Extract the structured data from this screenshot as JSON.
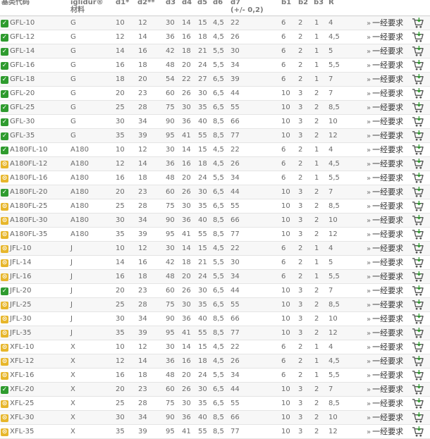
{
  "header": {
    "code": "基类代码",
    "material_line1": "iglidur®",
    "material_line2": "材料",
    "d1": "d1*",
    "d2": "d2**",
    "d3": "d3",
    "d4": "d4",
    "d5": "d5",
    "d6": "d6",
    "d7_line1": "d7",
    "d7_line2": "(+/- 0,2)",
    "b1": "b1",
    "b2": "b2",
    "b3": "b3",
    "r": "R"
  },
  "link": {
    "arrow": "»",
    "label": "一经要求"
  },
  "colors": {
    "green": "#2e9b2e",
    "yellow": "#e7b62b"
  },
  "rows": [
    {
      "status": "green",
      "status_icon": "check-icon",
      "code": "GFL-10",
      "material": "G",
      "d1": "10",
      "d2": "12",
      "d3": "30",
      "d4": "14",
      "d5": "15",
      "d6": "4,5",
      "d7": "22",
      "b1": "6",
      "b2": "2",
      "b3": "1",
      "r": "4"
    },
    {
      "status": "green",
      "status_icon": "check-icon",
      "code": "GFL-12",
      "material": "G",
      "d1": "12",
      "d2": "14",
      "d3": "36",
      "d4": "16",
      "d5": "18",
      "d6": "4,5",
      "d7": "26",
      "b1": "6",
      "b2": "2",
      "b3": "1",
      "r": "4,5"
    },
    {
      "status": "green",
      "status_icon": "check-icon",
      "code": "GFL-14",
      "material": "G",
      "d1": "14",
      "d2": "16",
      "d3": "42",
      "d4": "18",
      "d5": "21",
      "d6": "5,5",
      "d7": "30",
      "b1": "6",
      "b2": "2",
      "b3": "1",
      "r": "5"
    },
    {
      "status": "green",
      "status_icon": "check-icon",
      "code": "GFL-16",
      "material": "G",
      "d1": "16",
      "d2": "18",
      "d3": "48",
      "d4": "20",
      "d5": "24",
      "d6": "5,5",
      "d7": "34",
      "b1": "6",
      "b2": "2",
      "b3": "1",
      "r": "5,5"
    },
    {
      "status": "green",
      "status_icon": "check-icon",
      "code": "GFL-18",
      "material": "G",
      "d1": "18",
      "d2": "20",
      "d3": "54",
      "d4": "22",
      "d5": "27",
      "d6": "6,5",
      "d7": "39",
      "b1": "6",
      "b2": "2",
      "b3": "1",
      "r": "7"
    },
    {
      "status": "green",
      "status_icon": "check-icon",
      "code": "GFL-20",
      "material": "G",
      "d1": "20",
      "d2": "23",
      "d3": "60",
      "d4": "26",
      "d5": "30",
      "d6": "6,5",
      "d7": "44",
      "b1": "10",
      "b2": "3",
      "b3": "2",
      "r": "7"
    },
    {
      "status": "green",
      "status_icon": "check-icon",
      "code": "GFL-25",
      "material": "G",
      "d1": "25",
      "d2": "28",
      "d3": "75",
      "d4": "30",
      "d5": "35",
      "d6": "6,5",
      "d7": "55",
      "b1": "10",
      "b2": "3",
      "b3": "2",
      "r": "8,5"
    },
    {
      "status": "green",
      "status_icon": "check-icon",
      "code": "GFL-30",
      "material": "G",
      "d1": "30",
      "d2": "34",
      "d3": "90",
      "d4": "36",
      "d5": "40",
      "d6": "8,5",
      "d7": "66",
      "b1": "10",
      "b2": "3",
      "b3": "2",
      "r": "10"
    },
    {
      "status": "green",
      "status_icon": "check-icon",
      "code": "GFL-35",
      "material": "G",
      "d1": "35",
      "d2": "39",
      "d3": "95",
      "d4": "41",
      "d5": "55",
      "d6": "8,5",
      "d7": "77",
      "b1": "10",
      "b2": "3",
      "b3": "2",
      "r": "12"
    },
    {
      "status": "green",
      "status_icon": "check-icon",
      "code": "A180FL-10",
      "material": "A180",
      "d1": "10",
      "d2": "12",
      "d3": "30",
      "d4": "14",
      "d5": "15",
      "d6": "4,5",
      "d7": "22",
      "b1": "6",
      "b2": "2",
      "b3": "1",
      "r": "4"
    },
    {
      "status": "yellow",
      "status_icon": "clock-icon",
      "code": "A180FL-12",
      "material": "A180",
      "d1": "12",
      "d2": "14",
      "d3": "36",
      "d4": "16",
      "d5": "18",
      "d6": "4,5",
      "d7": "26",
      "b1": "6",
      "b2": "2",
      "b3": "1",
      "r": "4,5"
    },
    {
      "status": "yellow",
      "status_icon": "clock-icon",
      "code": "A180FL-16",
      "material": "A180",
      "d1": "16",
      "d2": "18",
      "d3": "48",
      "d4": "20",
      "d5": "24",
      "d6": "5,5",
      "d7": "34",
      "b1": "6",
      "b2": "2",
      "b3": "1",
      "r": "5,5"
    },
    {
      "status": "green",
      "status_icon": "check-icon",
      "code": "A180FL-20",
      "material": "A180",
      "d1": "20",
      "d2": "23",
      "d3": "60",
      "d4": "26",
      "d5": "30",
      "d6": "6,5",
      "d7": "44",
      "b1": "10",
      "b2": "3",
      "b3": "2",
      "r": "7"
    },
    {
      "status": "yellow",
      "status_icon": "clock-icon",
      "code": "A180FL-25",
      "material": "A180",
      "d1": "25",
      "d2": "28",
      "d3": "75",
      "d4": "30",
      "d5": "35",
      "d6": "6,5",
      "d7": "55",
      "b1": "10",
      "b2": "3",
      "b3": "2",
      "r": "8,5"
    },
    {
      "status": "yellow",
      "status_icon": "clock-icon",
      "code": "A180FL-30",
      "material": "A180",
      "d1": "30",
      "d2": "34",
      "d3": "90",
      "d4": "36",
      "d5": "40",
      "d6": "8,5",
      "d7": "66",
      "b1": "10",
      "b2": "3",
      "b3": "2",
      "r": "10"
    },
    {
      "status": "yellow",
      "status_icon": "clock-icon",
      "code": "A180FL-35",
      "material": "A180",
      "d1": "35",
      "d2": "39",
      "d3": "95",
      "d4": "41",
      "d5": "55",
      "d6": "8,5",
      "d7": "77",
      "b1": "10",
      "b2": "3",
      "b3": "2",
      "r": "12"
    },
    {
      "status": "yellow",
      "status_icon": "clock-icon",
      "code": "JFL-10",
      "material": "J",
      "d1": "10",
      "d2": "12",
      "d3": "30",
      "d4": "14",
      "d5": "15",
      "d6": "4,5",
      "d7": "22",
      "b1": "6",
      "b2": "2",
      "b3": "1",
      "r": "4"
    },
    {
      "status": "yellow",
      "status_icon": "clock-icon",
      "code": "JFL-14",
      "material": "J",
      "d1": "14",
      "d2": "16",
      "d3": "42",
      "d4": "18",
      "d5": "21",
      "d6": "5,5",
      "d7": "30",
      "b1": "6",
      "b2": "2",
      "b3": "1",
      "r": "5"
    },
    {
      "status": "yellow",
      "status_icon": "clock-icon",
      "code": "JFL-16",
      "material": "J",
      "d1": "16",
      "d2": "18",
      "d3": "48",
      "d4": "20",
      "d5": "24",
      "d6": "5,5",
      "d7": "34",
      "b1": "6",
      "b2": "2",
      "b3": "1",
      "r": "5,5"
    },
    {
      "status": "green",
      "status_icon": "check-icon",
      "code": "JFL-20",
      "material": "J",
      "d1": "20",
      "d2": "23",
      "d3": "60",
      "d4": "26",
      "d5": "30",
      "d6": "6,5",
      "d7": "44",
      "b1": "10",
      "b2": "3",
      "b3": "2",
      "r": "7"
    },
    {
      "status": "yellow",
      "status_icon": "clock-icon",
      "code": "JFL-25",
      "material": "J",
      "d1": "25",
      "d2": "28",
      "d3": "75",
      "d4": "30",
      "d5": "35",
      "d6": "6,5",
      "d7": "55",
      "b1": "10",
      "b2": "3",
      "b3": "2",
      "r": "8,5"
    },
    {
      "status": "yellow",
      "status_icon": "clock-icon",
      "code": "JFL-30",
      "material": "J",
      "d1": "30",
      "d2": "34",
      "d3": "90",
      "d4": "36",
      "d5": "40",
      "d6": "8,5",
      "d7": "66",
      "b1": "10",
      "b2": "3",
      "b3": "2",
      "r": "10"
    },
    {
      "status": "yellow",
      "status_icon": "clock-icon",
      "code": "JFL-35",
      "material": "J",
      "d1": "35",
      "d2": "39",
      "d3": "95",
      "d4": "41",
      "d5": "55",
      "d6": "8,5",
      "d7": "77",
      "b1": "10",
      "b2": "3",
      "b3": "2",
      "r": "12"
    },
    {
      "status": "yellow",
      "status_icon": "clock-icon",
      "code": "XFL-10",
      "material": "X",
      "d1": "10",
      "d2": "12",
      "d3": "30",
      "d4": "14",
      "d5": "15",
      "d6": "4,5",
      "d7": "22",
      "b1": "6",
      "b2": "2",
      "b3": "1",
      "r": "4"
    },
    {
      "status": "yellow",
      "status_icon": "clock-icon",
      "code": "XFL-12",
      "material": "X",
      "d1": "12",
      "d2": "14",
      "d3": "36",
      "d4": "16",
      "d5": "18",
      "d6": "4,5",
      "d7": "26",
      "b1": "6",
      "b2": "2",
      "b3": "1",
      "r": "4,5"
    },
    {
      "status": "yellow",
      "status_icon": "clock-icon",
      "code": "XFL-16",
      "material": "X",
      "d1": "16",
      "d2": "18",
      "d3": "48",
      "d4": "20",
      "d5": "24",
      "d6": "5,5",
      "d7": "34",
      "b1": "6",
      "b2": "2",
      "b3": "1",
      "r": "5,5"
    },
    {
      "status": "green",
      "status_icon": "check-icon",
      "code": "XFL-20",
      "material": "X",
      "d1": "20",
      "d2": "23",
      "d3": "60",
      "d4": "26",
      "d5": "30",
      "d6": "6,5",
      "d7": "44",
      "b1": "10",
      "b2": "3",
      "b3": "2",
      "r": "7"
    },
    {
      "status": "yellow",
      "status_icon": "clock-icon",
      "code": "XFL-25",
      "material": "X",
      "d1": "25",
      "d2": "28",
      "d3": "75",
      "d4": "30",
      "d5": "35",
      "d6": "6,5",
      "d7": "55",
      "b1": "10",
      "b2": "3",
      "b3": "2",
      "r": "8,5"
    },
    {
      "status": "yellow",
      "status_icon": "clock-icon",
      "code": "XFL-30",
      "material": "X",
      "d1": "30",
      "d2": "34",
      "d3": "90",
      "d4": "36",
      "d5": "40",
      "d6": "8,5",
      "d7": "66",
      "b1": "10",
      "b2": "3",
      "b3": "2",
      "r": "10"
    },
    {
      "status": "yellow",
      "status_icon": "clock-icon",
      "code": "XFL-35",
      "material": "X",
      "d1": "35",
      "d2": "39",
      "d3": "95",
      "d4": "41",
      "d5": "55",
      "d6": "8,5",
      "d7": "77",
      "b1": "10",
      "b2": "3",
      "b3": "2",
      "r": "12"
    }
  ]
}
